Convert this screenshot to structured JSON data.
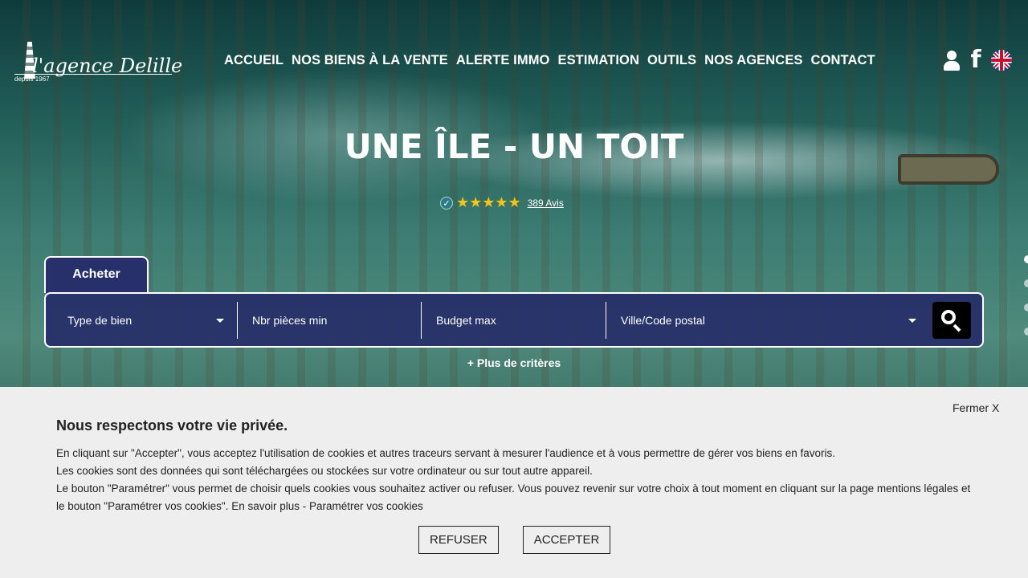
{
  "brand": {
    "logo_name": "l'agence Delille",
    "logo_since": "depuis 1967"
  },
  "nav": {
    "items": [
      {
        "label": "ACCUEIL"
      },
      {
        "label": "NOS BIENS À LA VENTE"
      },
      {
        "label": "ALERTE IMMO"
      },
      {
        "label": "ESTIMATION"
      },
      {
        "label": "OUTILS"
      },
      {
        "label": "NOS AGENCES"
      },
      {
        "label": "CONTACT"
      }
    ]
  },
  "header_icons": {
    "user_icon": "user-icon",
    "facebook_icon": "facebook-icon",
    "facebook_glyph": "f",
    "language_icon": "uk-flag-icon"
  },
  "hero": {
    "title": "UNE ÎLE - UN TOIT",
    "rating_stars": 5,
    "reviews_link": "389 Avis"
  },
  "search": {
    "tab_label": "Acheter",
    "property_type_placeholder": "Type de bien",
    "rooms_placeholder": "Nbr pièces min",
    "budget_placeholder": "Budget max",
    "location_placeholder": "Ville/Code postal",
    "more_criteria": "+ Plus de critères"
  },
  "cookie_banner": {
    "close_label": "Fermer X",
    "title": "Nous respectons votre vie privée.",
    "lines": [
      "En cliquant sur \"Accepter\", vous acceptez l'utilisation de cookies et autres traceurs servant à mesurer l'audience et à vous permettre de gérer vos biens en favoris.",
      "Les cookies sont des données qui sont téléchargées ou stockées sur votre ordinateur ou sur tout autre appareil.",
      "Le bouton \"Paramétrer\" vous permet de choisir quels cookies vous souhaitez activer ou refuser. Vous pouvez revenir sur votre choix à tout moment en cliquant sur la page mentions légales et le bouton \"Paramétrer vos cookies\". En savoir plus - Paramétrer vos cookies"
    ],
    "refuse_label": "REFUSER",
    "accept_label": "ACCEPTER"
  },
  "colors": {
    "search_bg": "#262e68",
    "star": "#f5c518",
    "banner_bg": "#eeeeee"
  }
}
